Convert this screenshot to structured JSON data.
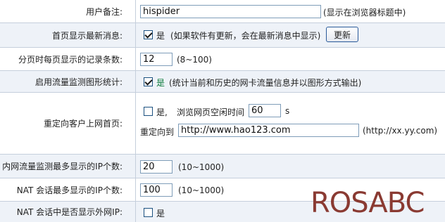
{
  "rows": {
    "remark": {
      "label": "用户备注:",
      "value": "hispider",
      "hint": "(显示在浏览器标题中)"
    },
    "show_news": {
      "label": "首页显示最新消息:",
      "checked": true,
      "text": "是",
      "hint": "(如果软件有更新，会在最新消息中显示)",
      "button": "更新"
    },
    "page_size": {
      "label": "分页时每页显示的记录条数:",
      "value": "12",
      "hint": "(8~100)"
    },
    "traffic_graph": {
      "label": "启用流量监测图形统计:",
      "checked": true,
      "text": "是",
      "hint": "(统计当前和历史的网卡流量信息并以图形方式输出)"
    },
    "redirect": {
      "label": "重定向客户上网首页:",
      "checked": false,
      "yes": "是,",
      "idle_text": "浏览网页空闲时间",
      "idle_value": "60",
      "unit": "s",
      "to_label": "重定向到",
      "url": "http://www.hao123.com",
      "url_hint": "(http://xx.yy.com)"
    },
    "lan_ip_count": {
      "label": "内网流量监测最多显示的IP个数:",
      "value": "20",
      "hint": "(10~1000)"
    },
    "nat_ip_count": {
      "label": "NAT 会话最多显示的IP个数:",
      "value": "100",
      "hint": "(10~1000)"
    },
    "nat_show_wan": {
      "label": "NAT 会话中是否显示外网IP:",
      "checked": false,
      "text": "是"
    }
  },
  "watermark": "ROSABC"
}
